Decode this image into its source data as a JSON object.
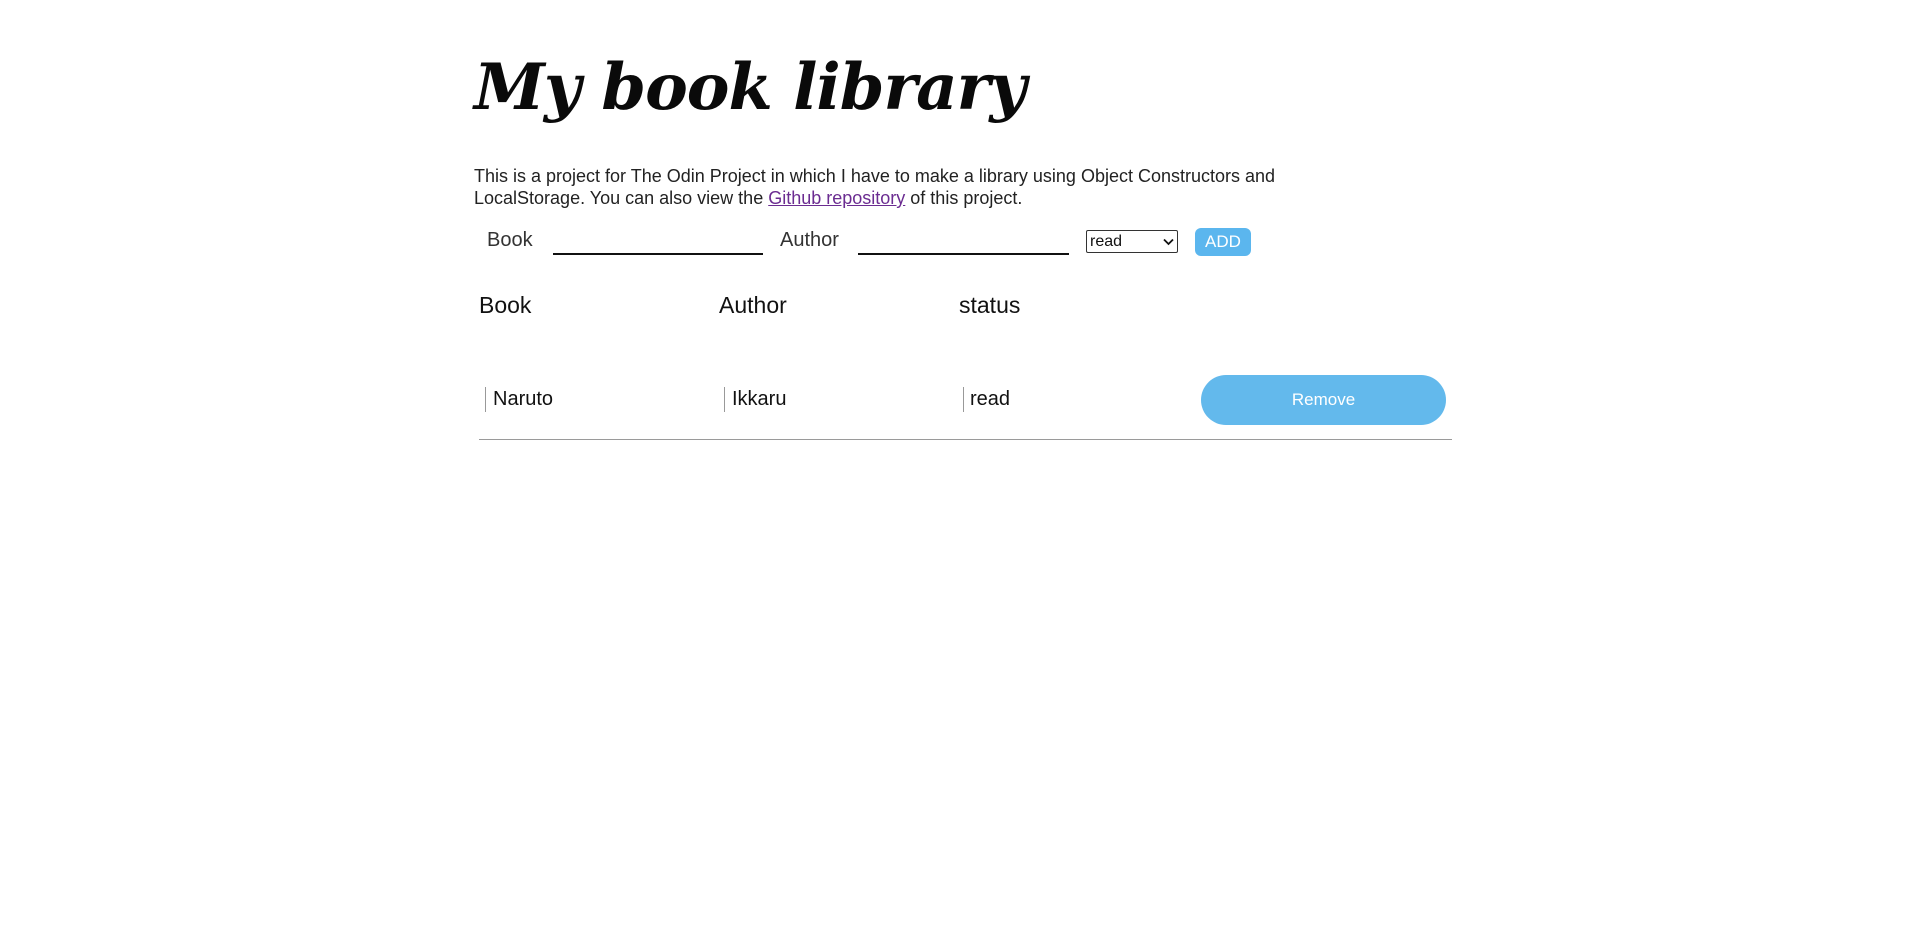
{
  "header": {
    "title": "My book library"
  },
  "intro": {
    "text_before_link": "This is a project for The Odin Project in which I have to make a library using Object Constructors and LocalStorage. You can also view the ",
    "link_text": "Github repository",
    "text_after_link": " of this project."
  },
  "form": {
    "book_label": "Book",
    "book_value": "",
    "author_label": "Author",
    "author_value": "",
    "status_selected": "read",
    "add_label": "ADD"
  },
  "table": {
    "headers": [
      "Book",
      "Author",
      "status"
    ],
    "rows": [
      {
        "book": "Naruto",
        "author": "Ikkaru",
        "status": "read",
        "action_label": "Remove"
      }
    ]
  },
  "colors": {
    "accent": "#5bb6ee",
    "link": "#6b2c91"
  }
}
